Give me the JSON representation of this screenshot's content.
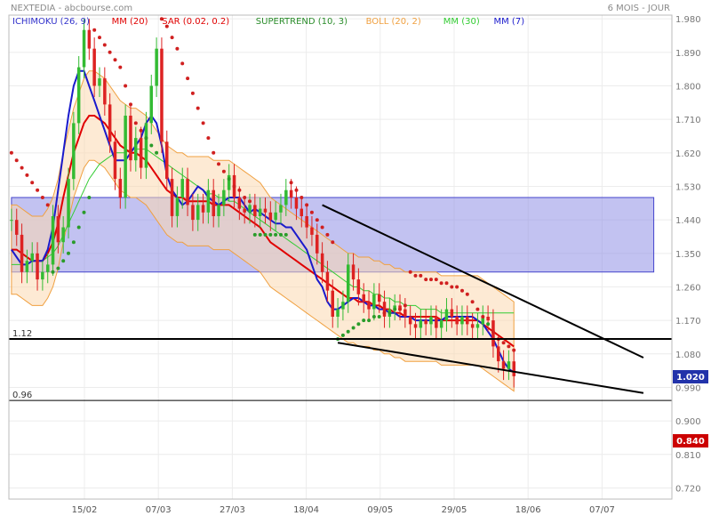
{
  "header": {
    "instrument": "NEXTEDIA - abcbourse.com",
    "period": "6 MOIS - JOUR"
  },
  "indicators": [
    {
      "label": "ICHIMOKU (26, 9)",
      "color": "#3333cc"
    },
    {
      "label": "MM (20)",
      "color": "#e00000"
    },
    {
      "label": "SAR (0.02, 0.2)",
      "color": "#e00000"
    },
    {
      "label": "SUPERTREND (10, 3)",
      "color": "#2a8c2a"
    },
    {
      "label": "BOLL (20, 2)",
      "color": "#f0a040"
    },
    {
      "label": "MM (30)",
      "color": "#33cc33"
    },
    {
      "label": "MM (7)",
      "color": "#1a1acc"
    }
  ],
  "price_badges": {
    "last": "1.020",
    "last_color": "#2233aa",
    "ref": "0.840",
    "ref_color": "#cc0000"
  },
  "levels": [
    {
      "label": "1.12",
      "value": 1.12
    },
    {
      "label": "0.96",
      "value": 0.955
    }
  ],
  "chart_data": {
    "type": "candlestick",
    "ylim": [
      0.69,
      1.99
    ],
    "yticks": [
      "1.980",
      "1.890",
      "1.800",
      "1.710",
      "1.620",
      "1.530",
      "1.440",
      "1.350",
      "1.260",
      "1.170",
      "1.080",
      "0.990",
      "0.900",
      "0.810",
      "0.720"
    ],
    "xticks": [
      "15/02",
      "07/03",
      "27/03",
      "18/04",
      "09/05",
      "29/05",
      "18/06",
      "07/07"
    ],
    "close": [
      1.44,
      1.4,
      1.3,
      1.33,
      1.35,
      1.28,
      1.3,
      1.32,
      1.45,
      1.38,
      1.42,
      1.55,
      1.7,
      1.85,
      1.95,
      1.9,
      1.8,
      1.82,
      1.75,
      1.65,
      1.55,
      1.5,
      1.72,
      1.6,
      1.66,
      1.58,
      1.7,
      1.8,
      1.9,
      1.65,
      1.55,
      1.45,
      1.5,
      1.55,
      1.48,
      1.44,
      1.48,
      1.46,
      1.52,
      1.45,
      1.48,
      1.52,
      1.56,
      1.5,
      1.47,
      1.46,
      1.48,
      1.45,
      1.47,
      1.46,
      1.44,
      1.46,
      1.48,
      1.52,
      1.5,
      1.47,
      1.45,
      1.42,
      1.4,
      1.35,
      1.3,
      1.25,
      1.18,
      1.2,
      1.22,
      1.32,
      1.28,
      1.24,
      1.22,
      1.2,
      1.24,
      1.22,
      1.18,
      1.2,
      1.21,
      1.2,
      1.18,
      1.16,
      1.15,
      1.17,
      1.16,
      1.18,
      1.15,
      1.17,
      1.2,
      1.18,
      1.16,
      1.18,
      1.16,
      1.15,
      1.16,
      1.18,
      1.17,
      1.1,
      1.06,
      1.04,
      1.06,
      1.02
    ],
    "ma7": [
      1.36,
      1.34,
      1.32,
      1.32,
      1.33,
      1.33,
      1.33,
      1.36,
      1.42,
      1.52,
      1.62,
      1.72,
      1.8,
      1.84,
      1.84,
      1.8,
      1.76,
      1.72,
      1.68,
      1.64,
      1.6,
      1.6,
      1.6,
      1.62,
      1.64,
      1.66,
      1.7,
      1.72,
      1.7,
      1.64,
      1.56,
      1.52,
      1.5,
      1.48,
      1.49,
      1.51,
      1.53,
      1.52,
      1.5,
      1.49,
      1.48,
      1.49,
      1.5,
      1.5,
      1.5,
      1.48,
      1.46,
      1.47,
      1.46,
      1.45,
      1.44,
      1.43,
      1.43,
      1.42,
      1.42,
      1.4,
      1.38,
      1.36,
      1.32,
      1.28,
      1.26,
      1.22,
      1.2,
      1.2,
      1.21,
      1.22,
      1.23,
      1.23,
      1.22,
      1.21,
      1.21,
      1.2,
      1.2,
      1.19,
      1.19,
      1.18,
      1.18,
      1.18,
      1.17,
      1.17,
      1.17,
      1.17,
      1.17,
      1.17,
      1.18,
      1.18,
      1.18,
      1.18,
      1.18,
      1.18,
      1.17,
      1.16,
      1.14,
      1.12,
      1.09,
      1.06,
      1.04,
      1.03
    ],
    "ma20": [
      1.36,
      1.36,
      1.35,
      1.34,
      1.33,
      1.33,
      1.33,
      1.35,
      1.38,
      1.43,
      1.5,
      1.56,
      1.62,
      1.66,
      1.7,
      1.72,
      1.72,
      1.71,
      1.7,
      1.68,
      1.66,
      1.64,
      1.63,
      1.62,
      1.62,
      1.61,
      1.6,
      1.58,
      1.56,
      1.54,
      1.52,
      1.51,
      1.5,
      1.5,
      1.49,
      1.49,
      1.49,
      1.49,
      1.49,
      1.48,
      1.48,
      1.48,
      1.48,
      1.47,
      1.46,
      1.45,
      1.44,
      1.43,
      1.42,
      1.4,
      1.38,
      1.37,
      1.36,
      1.35,
      1.34,
      1.33,
      1.32,
      1.31,
      1.3,
      1.29,
      1.28,
      1.27,
      1.26,
      1.25,
      1.24,
      1.23,
      1.23,
      1.22,
      1.22,
      1.22,
      1.21,
      1.21,
      1.2,
      1.2,
      1.19,
      1.19,
      1.18,
      1.18,
      1.18,
      1.18,
      1.18,
      1.18,
      1.18,
      1.17,
      1.17,
      1.17,
      1.17,
      1.17,
      1.17,
      1.17,
      1.17,
      1.16,
      1.15,
      1.14,
      1.13,
      1.12,
      1.11,
      1.1
    ],
    "ma30": [
      1.32,
      1.32,
      1.32,
      1.32,
      1.33,
      1.33,
      1.33,
      1.34,
      1.35,
      1.37,
      1.4,
      1.43,
      1.46,
      1.49,
      1.52,
      1.55,
      1.57,
      1.59,
      1.6,
      1.61,
      1.62,
      1.62,
      1.62,
      1.63,
      1.63,
      1.63,
      1.63,
      1.62,
      1.61,
      1.6,
      1.59,
      1.58,
      1.57,
      1.56,
      1.55,
      1.54,
      1.53,
      1.52,
      1.51,
      1.51,
      1.5,
      1.5,
      1.49,
      1.49,
      1.48,
      1.47,
      1.46,
      1.45,
      1.44,
      1.43,
      1.42,
      1.41,
      1.4,
      1.39,
      1.38,
      1.37,
      1.36,
      1.35,
      1.34,
      1.33,
      1.32,
      1.31,
      1.3,
      1.29,
      1.28,
      1.27,
      1.26,
      1.26,
      1.25,
      1.25,
      1.24,
      1.24,
      1.23,
      1.23,
      1.22,
      1.22,
      1.21,
      1.21,
      1.21,
      1.2,
      1.2,
      1.2,
      1.2,
      1.19,
      1.19,
      1.19,
      1.19,
      1.19,
      1.19,
      1.19,
      1.19,
      1.19,
      1.19,
      1.19,
      1.19,
      1.19,
      1.19,
      1.19
    ],
    "sar": [
      1.62,
      1.6,
      1.58,
      1.56,
      1.54,
      1.52,
      1.5,
      1.48,
      1.3,
      1.31,
      1.33,
      1.35,
      1.38,
      1.42,
      1.46,
      1.5,
      1.95,
      1.93,
      1.91,
      1.89,
      1.87,
      1.85,
      1.8,
      1.75,
      1.7,
      1.68,
      1.66,
      1.64,
      1.62,
      1.98,
      1.96,
      1.93,
      1.9,
      1.86,
      1.82,
      1.78,
      1.74,
      1.7,
      1.66,
      1.62,
      1.59,
      1.57,
      1.55,
      1.53,
      1.52,
      1.5,
      1.49,
      1.4,
      1.4,
      1.4,
      1.4,
      1.4,
      1.4,
      1.4,
      1.54,
      1.52,
      1.5,
      1.48,
      1.46,
      1.44,
      1.42,
      1.4,
      1.38,
      1.12,
      1.13,
      1.14,
      1.15,
      1.16,
      1.17,
      1.17,
      1.18,
      1.18,
      1.19,
      1.19,
      1.2,
      1.2,
      1.21,
      1.3,
      1.29,
      1.29,
      1.28,
      1.28,
      1.28,
      1.27,
      1.27,
      1.26,
      1.26,
      1.25,
      1.24,
      1.22,
      1.2,
      1.18,
      1.16,
      1.14,
      1.12,
      1.11,
      1.1,
      1.09
    ],
    "cloud_top": [
      1.5,
      1.5,
      1.5,
      1.5,
      1.5,
      1.5,
      1.5,
      1.5,
      1.5,
      1.5,
      1.5,
      1.5,
      1.5,
      1.5,
      1.5,
      1.5,
      1.5,
      1.5,
      1.5,
      1.5,
      1.5,
      1.5,
      1.5,
      1.5,
      1.5,
      1.5,
      1.5,
      1.5,
      1.5,
      1.5,
      1.5,
      1.5,
      1.5,
      1.5,
      1.5,
      1.5,
      1.5,
      1.5,
      1.5,
      1.5,
      1.5,
      1.5,
      1.5,
      1.5,
      1.5,
      1.5,
      1.5,
      1.5,
      1.5,
      1.5,
      1.5,
      1.5,
      1.5,
      1.5,
      1.5,
      1.5,
      1.5,
      1.5,
      1.5,
      1.5,
      1.5,
      1.5,
      1.5,
      1.5,
      1.5,
      1.5,
      1.5,
      1.5,
      1.5,
      1.5,
      1.5,
      1.5,
      1.5,
      1.5,
      1.5,
      1.5,
      1.5,
      1.5,
      1.5,
      1.5,
      1.5,
      1.5,
      1.5,
      1.5,
      1.5,
      1.5,
      1.5,
      1.5,
      1.5,
      1.5,
      1.5,
      1.5,
      1.5,
      1.5,
      1.5,
      1.5,
      1.5,
      1.5
    ],
    "cloud_bottom": [
      1.3,
      1.3,
      1.3,
      1.3,
      1.3,
      1.3,
      1.3,
      1.3,
      1.3,
      1.3,
      1.3,
      1.3,
      1.3,
      1.3,
      1.3,
      1.3,
      1.3,
      1.3,
      1.3,
      1.3,
      1.3,
      1.3,
      1.3,
      1.3,
      1.3,
      1.3,
      1.3,
      1.3,
      1.3,
      1.3,
      1.3,
      1.3,
      1.3,
      1.3,
      1.3,
      1.3,
      1.3,
      1.3,
      1.3,
      1.3,
      1.3,
      1.3,
      1.3,
      1.3,
      1.3,
      1.3,
      1.3,
      1.3,
      1.3,
      1.3,
      1.3,
      1.3,
      1.3,
      1.3,
      1.3,
      1.3,
      1.3,
      1.3,
      1.3,
      1.3,
      1.3,
      1.3,
      1.3,
      1.3,
      1.3,
      1.3,
      1.3,
      1.3,
      1.3,
      1.3,
      1.3,
      1.3,
      1.3,
      1.3,
      1.3,
      1.3,
      1.3,
      1.3,
      1.3,
      1.3,
      1.3,
      1.3,
      1.3,
      1.3,
      1.3,
      1.3,
      1.3,
      1.3,
      1.3,
      1.3,
      1.3,
      1.3,
      1.3,
      1.3,
      1.3,
      1.3,
      1.3,
      1.3
    ],
    "cloud_ahead_top": [
      1.5,
      1.5,
      1.5,
      1.5,
      1.5,
      1.5,
      1.5,
      1.5,
      1.5,
      1.5,
      1.5,
      1.5,
      1.5,
      1.5,
      1.5,
      1.5,
      1.5,
      1.5,
      1.5,
      1.5,
      1.5,
      1.5,
      1.5,
      1.5,
      1.5,
      1.5,
      1.5
    ],
    "cloud_ahead_bottom": [
      1.3,
      1.3,
      1.3,
      1.3,
      1.3,
      1.3,
      1.3,
      1.3,
      1.3,
      1.3,
      1.3,
      1.3,
      1.3,
      1.3,
      1.3,
      1.3,
      1.3,
      1.3,
      1.3,
      1.3,
      1.3,
      1.3,
      1.3,
      1.3,
      1.3,
      1.3,
      1.3
    ]
  }
}
